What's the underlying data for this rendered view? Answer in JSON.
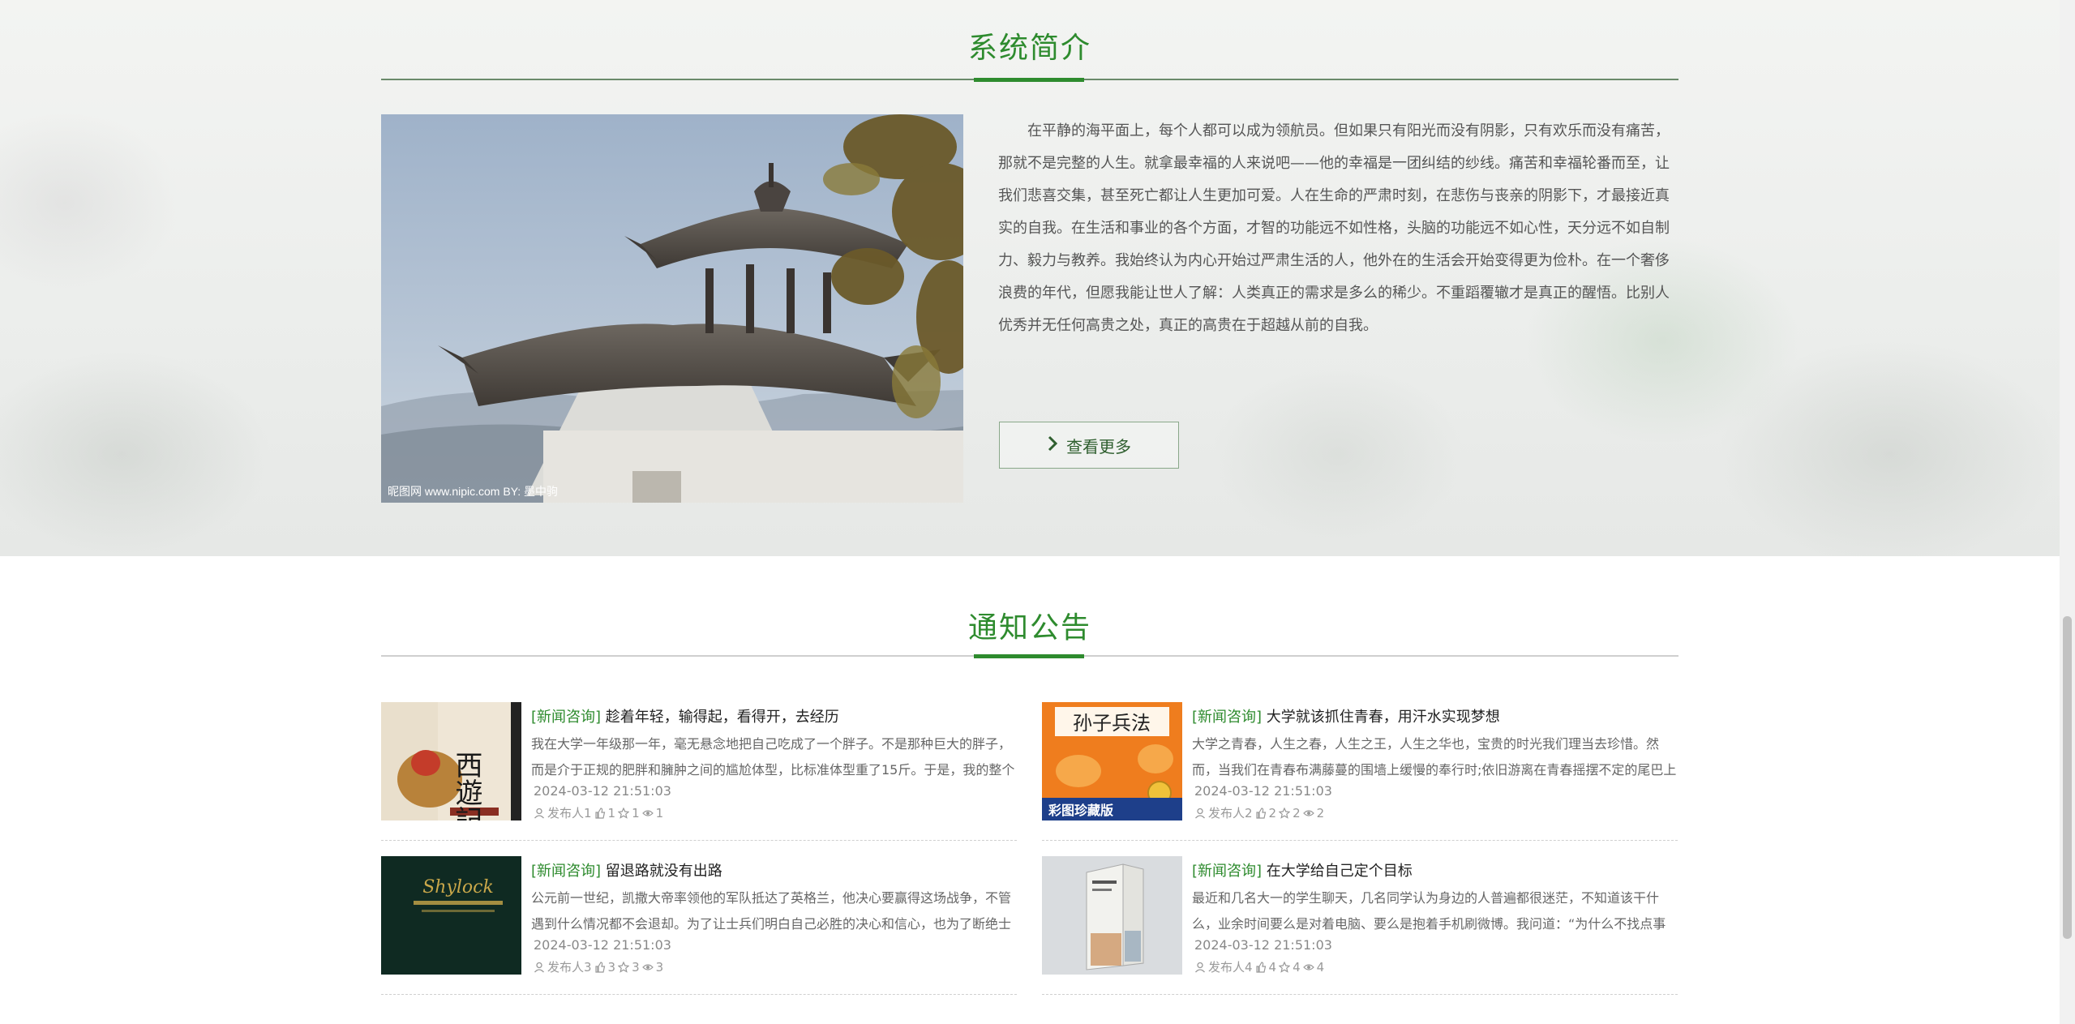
{
  "intro": {
    "title": "系统简介",
    "photo_watermark": "昵图网 www.nipic.com   BY: 墨中驹",
    "text": "在平静的海平面上，每个人都可以成为领航员。但如果只有阳光而没有阴影，只有欢乐而没有痛苦，那就不是完整的人生。就拿最幸福的人来说吧——他的幸福是一团纠结的纱线。痛苦和幸福轮番而至，让我们悲喜交集，甚至死亡都让人生更加可爱。人在生命的严肃时刻，在悲伤与丧亲的阴影下，才最接近真实的自我。在生活和事业的各个方面，才智的功能远不如性格，头脑的功能远不如心性，天分远不如自制力、毅力与教养。我始终认为内心开始过严肃生活的人，他外在的生活会开始变得更为俭朴。在一个奢侈浪费的年代，但愿我能让世人了解：人类真正的需求是多么的稀少。不重蹈覆辙才是真正的醒悟。比别人优秀并无任何高贵之处，真正的高贵在于超越从前的自我。",
    "more_label": "查看更多",
    "more_icon": "chevron-right-icon"
  },
  "notice": {
    "title": "通知公告",
    "items": [
      {
        "category": "[新闻咨询]",
        "title": "趁着年轻，输得起，看得开，去经历",
        "summary": "我在大学一年级那一年，毫无悬念地把自己吃成了一个胖子。不是那种巨大的胖子，而是介于正规的肥胖和臃肿之间的尴尬体型，比标准体型重了15斤。于是，我的整个",
        "time": "2024-03-12 21:51:03",
        "author": "发布人1",
        "likes": "1",
        "favorites": "1",
        "views": "1",
        "thumb_label": "西遊記"
      },
      {
        "category": "[新闻咨询]",
        "title": "大学就该抓住青春，用汗水实现梦想",
        "summary": "大学之青春，人生之春，人生之王，人生之华也，宝贵的时光我们理当去珍惜。然而，当我们在青春布满藤蔓的围墙上缓慢的奉行时;依旧游离在青春摇摆不定的尾巴上",
        "time": "2024-03-12 21:51:03",
        "author": "发布人2",
        "likes": "2",
        "favorites": "2",
        "views": "2",
        "thumb_label": "孙子兵法",
        "thumb_sub": "彩图珍藏版"
      },
      {
        "category": "[新闻咨询]",
        "title": "留退路就没有出路",
        "summary": "公元前一世纪，凯撒大帝率领他的军队抵达了英格兰，他决心要赢得这场战争，不管遇到什么情况都不会退却。为了让士兵们明白自己必胜的决心和信心，也为了断绝士",
        "time": "2024-03-12 21:51:03",
        "author": "发布人3",
        "likes": "3",
        "favorites": "3",
        "views": "3",
        "thumb_label": "Shylock"
      },
      {
        "category": "[新闻咨询]",
        "title": "在大学给自己定个目标",
        "summary": "最近和几名大一的学生聊天，几名同学认为身边的人普遍都很迷茫，不知道该干什么，业余时间要么是对着电脑、要么是抱着手机刷微博。我问道：“为什么不找点事情",
        "time": "2024-03-12 21:51:03",
        "author": "发布人4",
        "likes": "4",
        "favorites": "4",
        "views": "4"
      }
    ]
  },
  "colors": {
    "accent": "#2e8b2e",
    "text": "#555555",
    "muted": "#999999"
  }
}
